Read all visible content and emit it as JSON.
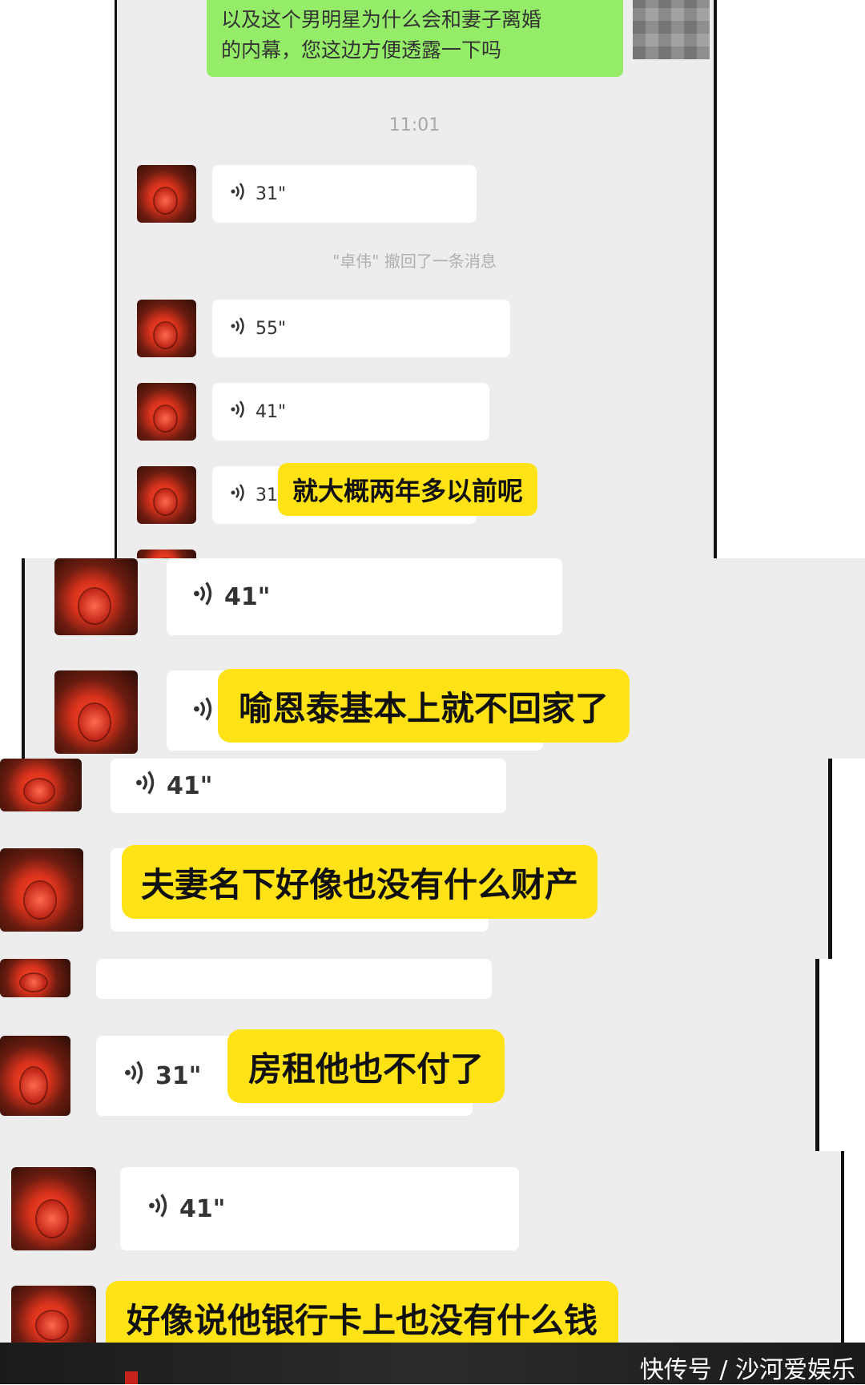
{
  "top_message": {
    "line1": "以及这个男明星为什么会和妻子离婚",
    "line2": "的内幕，您这边方便透露一下吗"
  },
  "timestamp": "11:01",
  "recall_notice": "\"卓伟\" 撤回了一条消息",
  "voice_messages": {
    "v1": "31\"",
    "v2": "55\"",
    "v3": "41\"",
    "v4": "31\"",
    "v5": "41\"",
    "v6": "41\"",
    "v7": "31\"",
    "v8": "41\""
  },
  "captions": {
    "c1": "就大概两年多以前呢",
    "c2": "喻恩泰基本上就不回家了",
    "c3": "夫妻名下好像也没有什么财产",
    "c4": "房租他也不付了",
    "c5": "好像说他银行卡上也没有什么钱"
  },
  "footer": {
    "credit": "快传号 / 沙河爱娱乐"
  },
  "colors": {
    "chat_background": "#ededed",
    "sent_bubble": "#95ec69",
    "caption_background": "#ffe316",
    "voice_bubble": "#ffffff"
  }
}
